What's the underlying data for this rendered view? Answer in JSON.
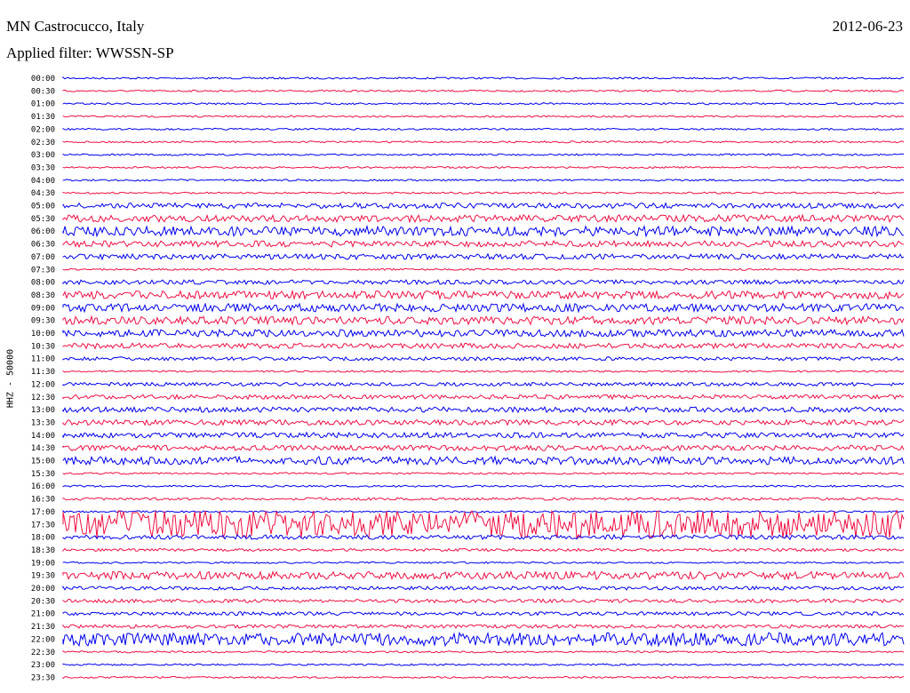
{
  "header": {
    "station": "MN Castrocucco, Italy",
    "date": "2012-06-23",
    "filter": "Applied filter: WWSSN-SP"
  },
  "chart_data": {
    "type": "line",
    "title": "MN Castrocucco, Italy",
    "ylabel": "HHZ - 50000",
    "colors": [
      "#0000ee",
      "#ee1144"
    ],
    "rows": [
      {
        "time": "00:00",
        "amp": 1
      },
      {
        "time": "00:30",
        "amp": 1
      },
      {
        "time": "01:00",
        "amp": 1
      },
      {
        "time": "01:30",
        "amp": 1
      },
      {
        "time": "02:00",
        "amp": 1
      },
      {
        "time": "02:30",
        "amp": 1
      },
      {
        "time": "03:00",
        "amp": 1
      },
      {
        "time": "03:30",
        "amp": 1
      },
      {
        "time": "04:00",
        "amp": 1
      },
      {
        "time": "04:30",
        "amp": 1
      },
      {
        "time": "05:00",
        "amp": 5
      },
      {
        "time": "05:30",
        "amp": 7
      },
      {
        "time": "06:00",
        "amp": 10
      },
      {
        "time": "06:30",
        "amp": 6
      },
      {
        "time": "07:00",
        "amp": 5
      },
      {
        "time": "07:30",
        "amp": 1
      },
      {
        "time": "08:00",
        "amp": 4
      },
      {
        "time": "08:30",
        "amp": 8
      },
      {
        "time": "09:00",
        "amp": 8
      },
      {
        "time": "09:30",
        "amp": 8
      },
      {
        "time": "10:00",
        "amp": 7
      },
      {
        "time": "10:30",
        "amp": 5
      },
      {
        "time": "11:00",
        "amp": 3
      },
      {
        "time": "11:30",
        "amp": 1
      },
      {
        "time": "12:00",
        "amp": 3
      },
      {
        "time": "12:30",
        "amp": 4
      },
      {
        "time": "13:00",
        "amp": 5
      },
      {
        "time": "13:30",
        "amp": 5
      },
      {
        "time": "14:00",
        "amp": 5
      },
      {
        "time": "14:30",
        "amp": 5
      },
      {
        "time": "15:00",
        "amp": 8
      },
      {
        "time": "15:30",
        "amp": 1
      },
      {
        "time": "16:00",
        "amp": 1
      },
      {
        "time": "16:30",
        "amp": 2
      },
      {
        "time": "17:00",
        "amp": 1
      },
      {
        "time": "17:30",
        "amp": 30
      },
      {
        "time": "18:00",
        "amp": 4
      },
      {
        "time": "18:30",
        "amp": 2
      },
      {
        "time": "19:00",
        "amp": 1
      },
      {
        "time": "19:30",
        "amp": 8
      },
      {
        "time": "20:00",
        "amp": 3
      },
      {
        "time": "20:30",
        "amp": 3
      },
      {
        "time": "21:00",
        "amp": 3
      },
      {
        "time": "21:30",
        "amp": 3
      },
      {
        "time": "22:00",
        "amp": 14
      },
      {
        "time": "22:30",
        "amp": 1
      },
      {
        "time": "23:00",
        "amp": 1
      },
      {
        "time": "23:30",
        "amp": 1
      }
    ]
  }
}
